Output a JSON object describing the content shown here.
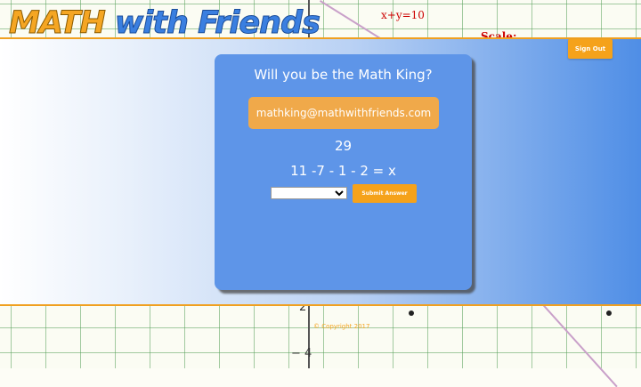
{
  "header": {
    "logo_word1": "MATH",
    "logo_word2": "with Friends",
    "signout_label": "Sign Out"
  },
  "graph": {
    "equation_label": "x+y=10",
    "scale_label": "Scale:",
    "tick_neg2": "2",
    "tick_neg4": "− 4"
  },
  "card": {
    "title": "Will you be the Math King?",
    "email": "mathking@mathwithfriends.com",
    "number": "29",
    "equation": "11 -7 - 1 - 2 = x",
    "answer_value": "",
    "submit_label": "Submit Answer"
  },
  "footer": {
    "copyright": "© Copyright 2017"
  },
  "colors": {
    "accent_orange": "#f5a21b",
    "card_blue": "#5e95e8",
    "logo_orange": "#f5a623",
    "logo_blue": "#3a7fe0"
  }
}
